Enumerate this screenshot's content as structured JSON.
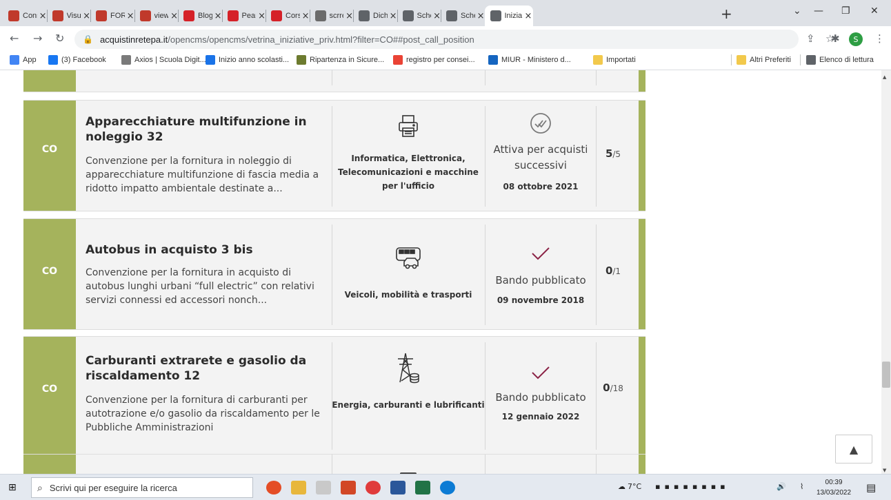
{
  "browser": {
    "tabs": [
      {
        "title": "Cons",
        "icon": "fs-icon",
        "color": "#c0392b"
      },
      {
        "title": "Visua",
        "icon": "fs-icon",
        "color": "#c0392b"
      },
      {
        "title": "FORM",
        "icon": "fs-icon",
        "color": "#c0392b"
      },
      {
        "title": "view_",
        "icon": "fs-icon",
        "color": "#c0392b"
      },
      {
        "title": "Blog",
        "icon": "pinterest-icon",
        "color": "#d52128"
      },
      {
        "title": "Pears",
        "icon": "pinterest-icon",
        "color": "#d52128"
      },
      {
        "title": "Corsi",
        "icon": "pinterest-icon",
        "color": "#d52128"
      },
      {
        "title": "scrre",
        "icon": "emblem-icon",
        "color": "#6b6b6b"
      },
      {
        "title": "Dich",
        "icon": "globe-icon",
        "color": "#5f6368"
      },
      {
        "title": "Sche",
        "icon": "globe-icon",
        "color": "#5f6368"
      },
      {
        "title": "Sche",
        "icon": "globe-icon",
        "color": "#5f6368"
      },
      {
        "title": "Inizia",
        "icon": "globe-icon",
        "color": "#5f6368",
        "active": true
      }
    ],
    "url_host": "acquistinretepa.it",
    "url_path": "/opencms/opencms/vetrina_iniziative_priv.html?filter=CO##post_call_position",
    "profile_initial": "S",
    "bookmarks": [
      {
        "label": "App",
        "icon": "apps-grid-icon",
        "color": "#4285f4"
      },
      {
        "label": "(3) Facebook",
        "icon": "facebook-icon",
        "color": "#1877f2"
      },
      {
        "label": "Axios | Scuola Digit...",
        "icon": "axios-icon",
        "color": "#7a7a7a"
      },
      {
        "label": "Inizio anno scolasti...",
        "icon": "globe-icon",
        "color": "#1a73e8"
      },
      {
        "label": "Ripartenza in Sicure...",
        "icon": "site-icon",
        "color": "#6d7b2f"
      },
      {
        "label": "registro per consei...",
        "icon": "google-icon",
        "color": "#ea4335"
      },
      {
        "label": "MIUR - Ministero d...",
        "icon": "miur-icon",
        "color": "#1565c0"
      },
      {
        "label": "Importati",
        "icon": "folder-icon",
        "color": "#f2c94c"
      },
      {
        "label": "Altri Preferiti",
        "icon": "folder-icon",
        "color": "#f2c94c"
      },
      {
        "label": "Elenco di lettura",
        "icon": "reading-list-icon",
        "color": "#5f6368"
      }
    ]
  },
  "cards": [
    {
      "code": "CO",
      "title": "Apparecchiature multifunzione in noleggio 32",
      "description": "Convenzione per la fornitura in noleggio di apparecchiature multifunzione di fascia media a ridotto impatto ambientale destinate a...",
      "category": "Informatica, Elettronica, Telecomunicazioni e macchine per l'ufficio",
      "category_icon": "printer-icon",
      "status": "Attiva per acquisti successivi",
      "status_icon": "double-check-circle-icon",
      "date": "08 ottobre 2021",
      "count_main": "5",
      "count_total": "/5"
    },
    {
      "code": "CO",
      "title": "Autobus in acquisto 3 bis",
      "description": "Convenzione per la fornitura in acquisto di autobus lunghi urbani “full electric” con relativi servizi connessi ed accessori nonch...",
      "category": "Veicoli, mobilità e trasporti",
      "category_icon": "bus-car-icon",
      "status": "Bando pubblicato",
      "status_icon": "checkmark-icon",
      "date": "09 novembre 2018",
      "count_main": "0",
      "count_total": "/1"
    },
    {
      "code": "CO",
      "title": "Carburanti extrarete e gasolio da riscaldamento 12",
      "description": "Convenzione per la fornitura di carburanti per autotrazione e/o gasolio da riscaldamento per le Pubbliche Amministrazioni",
      "category": "Energia, carburanti e lubrificanti",
      "category_icon": "power-pylon-icon",
      "status": "Bando pubblicato",
      "status_icon": "checkmark-icon",
      "date": "12 gennaio 2022",
      "count_main": "0",
      "count_total": "/18"
    }
  ],
  "colors": {
    "accent": "#a5b35c",
    "check": "#8b2346",
    "double_check": "#7a7a7a"
  },
  "taskbar": {
    "search_placeholder": "Scrivi qui per eseguire la ricerca",
    "weather": "7°C",
    "time": "00:39",
    "date": "13/03/2022"
  }
}
